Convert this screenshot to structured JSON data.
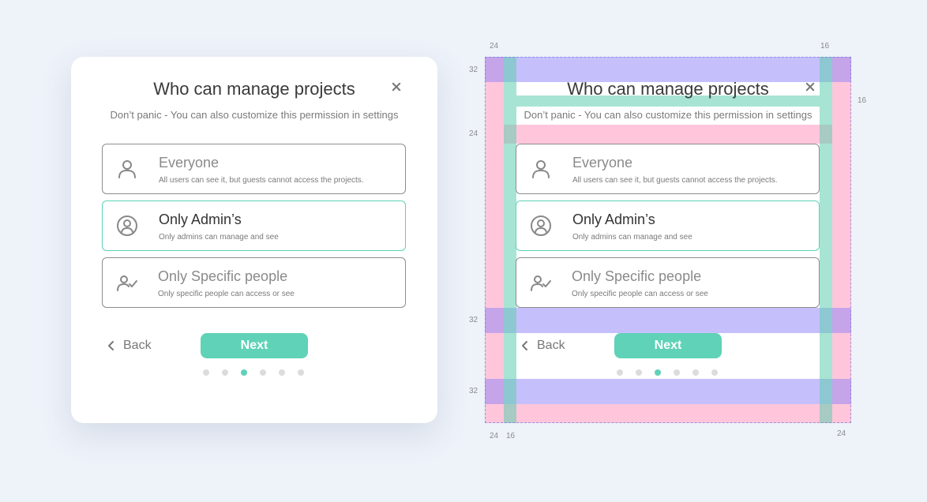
{
  "dialog": {
    "title": "Who can manage projects",
    "subtitle": "Don’t panic - You can also customize this permission in settings",
    "options": [
      {
        "title": "Everyone",
        "description": "All users can see it, but guests cannot access the projects.",
        "icon": "user-icon",
        "selected": false
      },
      {
        "title": "Only Admin’s",
        "description": "Only admins can manage and see",
        "icon": "user-circle-icon",
        "selected": true
      },
      {
        "title": "Only Specific people",
        "description": "Only specific people can access or see",
        "icon": "user-check-icon",
        "selected": false
      }
    ],
    "back_label": "Back",
    "next_label": "Next",
    "pagination": {
      "total": 6,
      "active_index": 2
    },
    "close_icon": "close-icon"
  },
  "spec": {
    "labels": {
      "top_left": "24",
      "top_right": "16",
      "left_top": "32",
      "right_top": "16",
      "left_mid": "24",
      "left_lower": "32",
      "left_bottom": "32",
      "bottom_left_a": "24",
      "bottom_left_b": "16",
      "bottom_right": "24"
    }
  },
  "colors": {
    "accent": "#5fd2b7",
    "background": "#eef2f9",
    "spacing_pink": "#ff78aa",
    "spacing_violet": "#8c82fa",
    "spacing_teal": "#5fcdaf"
  }
}
